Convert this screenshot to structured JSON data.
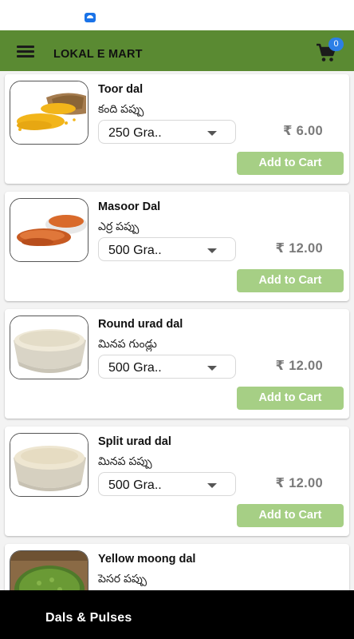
{
  "header": {
    "title": "LOKAL E MART",
    "cart_count": "0"
  },
  "products": [
    {
      "name": "Toor dal",
      "local_name": "కంది పప్పు",
      "quantity": "250 Gra..",
      "price": "₹ 6.00",
      "add_label": "Add to Cart"
    },
    {
      "name": "Masoor Dal",
      "local_name": "ఎర్ర పప్పు",
      "quantity": "500 Gra..",
      "price": "₹ 12.00",
      "add_label": "Add to Cart"
    },
    {
      "name": "Round urad dal",
      "local_name": "మినప గుండ్లు",
      "quantity": "500 Gra..",
      "price": "₹ 12.00",
      "add_label": "Add to Cart"
    },
    {
      "name": "Split urad dal",
      "local_name": "మినప పప్పు",
      "quantity": "500 Gra..",
      "price": "₹ 12.00",
      "add_label": "Add to Cart"
    },
    {
      "name": "Yellow moong dal",
      "local_name": "పెసర పప్పు",
      "quantity": "",
      "price": "",
      "add_label": ""
    }
  ],
  "bottom": {
    "category": "Dals & Pulses"
  },
  "colors": {
    "appbar": "#5a8a32",
    "add_button": "#a6cf85",
    "badge": "#2c7fe6",
    "bottom_bar": "#000000"
  },
  "icons": {
    "menu": "hamburger-icon",
    "cart": "shopping-cart-icon",
    "dropdown": "caret-down-icon"
  }
}
